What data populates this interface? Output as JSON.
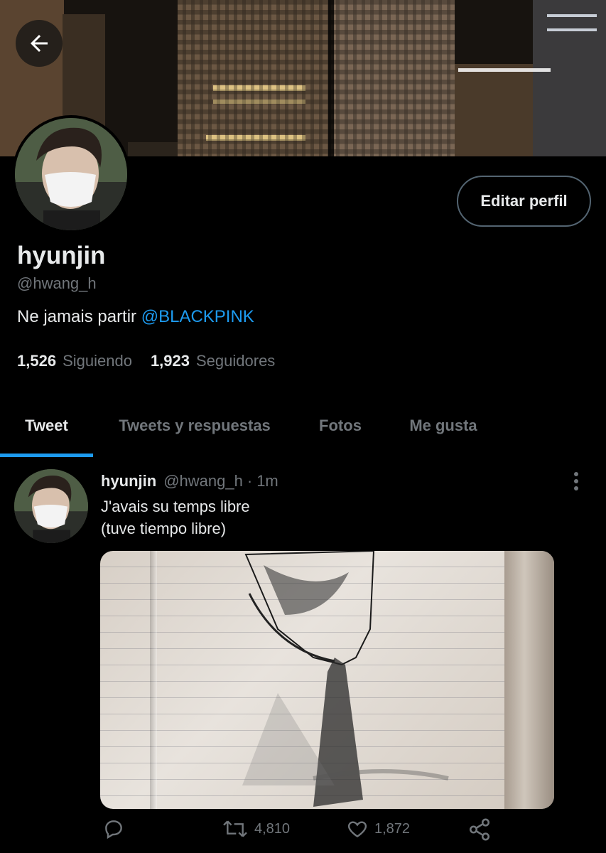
{
  "header": {
    "back_icon": "arrow-left-icon"
  },
  "profile": {
    "name": "hyunjin",
    "handle": "@hwang_h",
    "bio_text": "Ne jamais partir ",
    "bio_mention": "@BLACKPINK",
    "edit_button": "Editar perfil",
    "following_count": "1,526",
    "following_label": "Siguiendo",
    "followers_count": "1,923",
    "followers_label": "Seguidores"
  },
  "tabs": [
    {
      "label": "Tweet",
      "active": true
    },
    {
      "label": "Tweets y respuestas",
      "active": false
    },
    {
      "label": "Fotos",
      "active": false
    },
    {
      "label": "Me gusta",
      "active": false
    }
  ],
  "tweet": {
    "name": "hyunjin",
    "handle": "@hwang_h",
    "separator": "·",
    "time": "1m",
    "text": "J'avais su temps libre\n(tuve tiempo libre)",
    "retweets": "4,810",
    "likes": "1,872"
  },
  "colors": {
    "accent": "#1d9bf0",
    "background": "#000000",
    "muted": "#71767b"
  }
}
